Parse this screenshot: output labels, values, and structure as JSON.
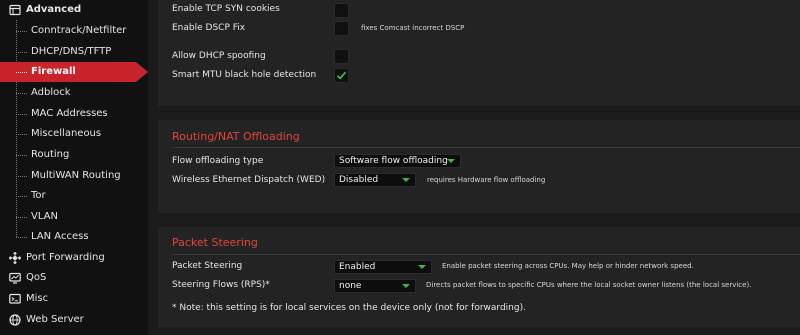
{
  "sidebar": {
    "section_label": "Advanced",
    "items": [
      {
        "label": "Conntrack/Netfilter"
      },
      {
        "label": "DHCP/DNS/TFTP"
      },
      {
        "label": "Firewall",
        "active": true
      },
      {
        "label": "Adblock"
      },
      {
        "label": "MAC Addresses"
      },
      {
        "label": "Miscellaneous"
      },
      {
        "label": "Routing"
      },
      {
        "label": "MultiWAN Routing"
      },
      {
        "label": "Tor"
      },
      {
        "label": "VLAN"
      },
      {
        "label": "LAN Access"
      }
    ],
    "groups": [
      {
        "label": "Port Forwarding",
        "icon": "port-forwarding-icon"
      },
      {
        "label": "QoS",
        "icon": "qos-icon"
      },
      {
        "label": "Misc",
        "icon": "misc-icon"
      },
      {
        "label": "Web Server",
        "icon": "web-server-icon"
      }
    ]
  },
  "general": {
    "rows": [
      {
        "label": "Enable TCP SYN cookies",
        "checked": false
      },
      {
        "label": "Enable DSCP Fix",
        "checked": false,
        "hint": "fixes Comcast incorrect DSCP"
      },
      {
        "label": "Allow DHCP spoofing",
        "checked": false
      },
      {
        "label": "Smart MTU black hole detection",
        "checked": true
      }
    ]
  },
  "offloading": {
    "title": "Routing/NAT Offloading",
    "flow_label": "Flow offloading type",
    "flow_value": "Software flow offloading",
    "wed_label": "Wireless Ethernet Dispatch (WED)",
    "wed_value": "Disabled",
    "wed_hint": "requires Hardware flow offloading"
  },
  "steering": {
    "title": "Packet Steering",
    "packet_label": "Packet Steering",
    "packet_value": "Enabled",
    "packet_hint": "Enable packet steering across CPUs. May help or hinder network speed.",
    "rps_label": "Steering Flows (RPS)*",
    "rps_value": "none",
    "rps_hint": "Directs packet flows to specific CPUs where the local socket owner listens (the local service).",
    "note": "* Note: this setting is for local services on the device only (not for forwarding)."
  },
  "colors": {
    "accent": "#c9232b",
    "section_title": "#e0453c",
    "check": "#3fb54a"
  }
}
